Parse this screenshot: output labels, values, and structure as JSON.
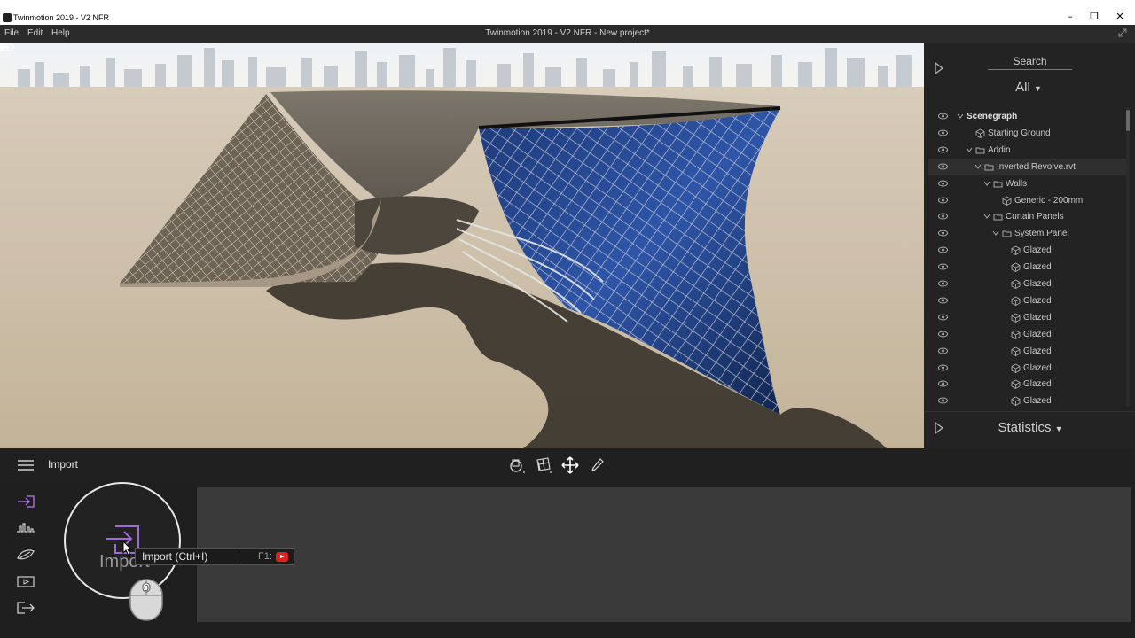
{
  "window": {
    "title": "Twinmotion 2019 - V2 NFR",
    "minimize_glyph": "–",
    "restore_glyph": "❐",
    "close_glyph": "✕"
  },
  "menu": {
    "items": [
      "File",
      "Edit",
      "Help"
    ],
    "project_title": "Twinmotion 2019 - V2 NFR - New project*"
  },
  "right_panel": {
    "search_label": "Search",
    "filter_value": "All",
    "tree": [
      {
        "label": "Scenegraph",
        "level": 0,
        "chevron": true,
        "icon": "none",
        "bold": true
      },
      {
        "label": "Starting Ground",
        "level": 1,
        "chevron": false,
        "icon": "object-icon"
      },
      {
        "label": "Addin",
        "level": 1,
        "chevron": true,
        "icon": "folder-icon"
      },
      {
        "label": "Inverted Revolve.rvt",
        "level": 2,
        "chevron": true,
        "icon": "folder-icon",
        "selected": true
      },
      {
        "label": "Walls",
        "level": 3,
        "chevron": true,
        "icon": "folder-icon"
      },
      {
        "label": "Generic - 200mm",
        "level": 4,
        "chevron": false,
        "icon": "object-icon"
      },
      {
        "label": "Curtain Panels",
        "level": 3,
        "chevron": true,
        "icon": "folder-icon"
      },
      {
        "label": "System Panel",
        "level": 4,
        "chevron": true,
        "icon": "folder-icon"
      },
      {
        "label": "Glazed",
        "level": 5,
        "chevron": false,
        "icon": "object-icon"
      },
      {
        "label": "Glazed",
        "level": 5,
        "chevron": false,
        "icon": "object-icon"
      },
      {
        "label": "Glazed",
        "level": 5,
        "chevron": false,
        "icon": "object-icon"
      },
      {
        "label": "Glazed",
        "level": 5,
        "chevron": false,
        "icon": "object-icon"
      },
      {
        "label": "Glazed",
        "level": 5,
        "chevron": false,
        "icon": "object-icon"
      },
      {
        "label": "Glazed",
        "level": 5,
        "chevron": false,
        "icon": "object-icon"
      },
      {
        "label": "Glazed",
        "level": 5,
        "chevron": false,
        "icon": "object-icon"
      },
      {
        "label": "Glazed",
        "level": 5,
        "chevron": false,
        "icon": "object-icon"
      },
      {
        "label": "Glazed",
        "level": 5,
        "chevron": false,
        "icon": "object-icon"
      },
      {
        "label": "Glazed",
        "level": 5,
        "chevron": false,
        "icon": "object-icon"
      }
    ],
    "statistics_label": "Statistics"
  },
  "toolbar": {
    "section_title": "Import",
    "tools": [
      "orbit-tool-icon",
      "grid-tool-icon",
      "move-tool-icon",
      "pencil-tool-icon"
    ]
  },
  "sidebar": {
    "icons": [
      "import-icon",
      "waveform-icon",
      "leaf-icon",
      "video-icon",
      "export-icon"
    ]
  },
  "import_tile": {
    "label": "Import",
    "tooltip_text": "Import (Ctrl+I)",
    "tooltip_key": "F1:",
    "mouse_hint": "0"
  },
  "colors": {
    "accent_purple": "#a06ad8",
    "panel_bg": "#232323",
    "glass_blue": "#1f3f86"
  }
}
